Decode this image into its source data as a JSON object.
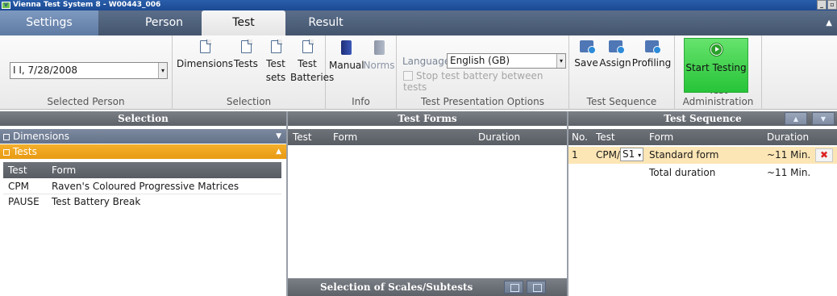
{
  "window": {
    "title": "Vienna Test System 8 - W00443_006",
    "app_icon": "vts-logo"
  },
  "tabs": [
    {
      "label": "Settings"
    },
    {
      "label": "Person"
    },
    {
      "label": "Test"
    },
    {
      "label": "Result"
    }
  ],
  "ribbon": {
    "selected_person": {
      "value": "I I, 7/28/2008",
      "group_label": "Selected Person"
    },
    "selection": {
      "buttons": [
        {
          "label": "Dimensions",
          "icon": "document-icon"
        },
        {
          "label": "Tests",
          "icon": "document-icon"
        },
        {
          "label": "Test sets",
          "icon": "document-icon"
        },
        {
          "label": "Test Batteries",
          "icon": "document-icon"
        }
      ],
      "group_label": "Selection"
    },
    "info": {
      "buttons": [
        {
          "label": "Manual",
          "icon": "book-icon"
        },
        {
          "label": "Norms",
          "icon": "book-icon"
        }
      ],
      "group_label": "Info"
    },
    "presentation": {
      "language_label": "Language",
      "language_value": "English (GB)",
      "stop_label": "Stop test battery between tests",
      "group_label": "Test Presentation Options"
    },
    "sequence": {
      "buttons": [
        {
          "label": "Save",
          "icon": "sequence-save-icon"
        },
        {
          "label": "Assign",
          "icon": "sequence-assign-icon"
        },
        {
          "label": "Profiling",
          "icon": "sequence-profiling-icon"
        }
      ],
      "group_label": "Test Sequence"
    },
    "administration": {
      "start_label": "Start Testing",
      "group_label": "Test Administration"
    }
  },
  "selection_panel": {
    "title": "Selection",
    "categories": [
      {
        "label": "Dimensions"
      },
      {
        "label": "Tests"
      }
    ],
    "columns": [
      "Test",
      "Form"
    ],
    "rows": [
      {
        "test": "CPM",
        "form": "Raven's Coloured Progressive Matrices"
      },
      {
        "test": "PAUSE",
        "form": "Test Battery Break"
      }
    ]
  },
  "forms_panel": {
    "title": "Test Forms",
    "columns": [
      "Test",
      "Form",
      "Duration"
    ],
    "footer_title": "Selection of Scales/Subtests"
  },
  "sequence_panel": {
    "title": "Test Sequence",
    "columns": [
      "No.",
      "Test",
      "Form",
      "Duration"
    ],
    "rows": [
      {
        "no": "1",
        "test": "CPM/",
        "form_select": "S1",
        "form": "Standard form",
        "duration": "~11 Min."
      }
    ],
    "total_label": "Total duration",
    "total_value": "~11 Min."
  },
  "colors": {
    "tab_bar": "#44556d",
    "active_category": "#e89a12",
    "start_button": "#27c438",
    "selected_row": "#fde6b5"
  }
}
